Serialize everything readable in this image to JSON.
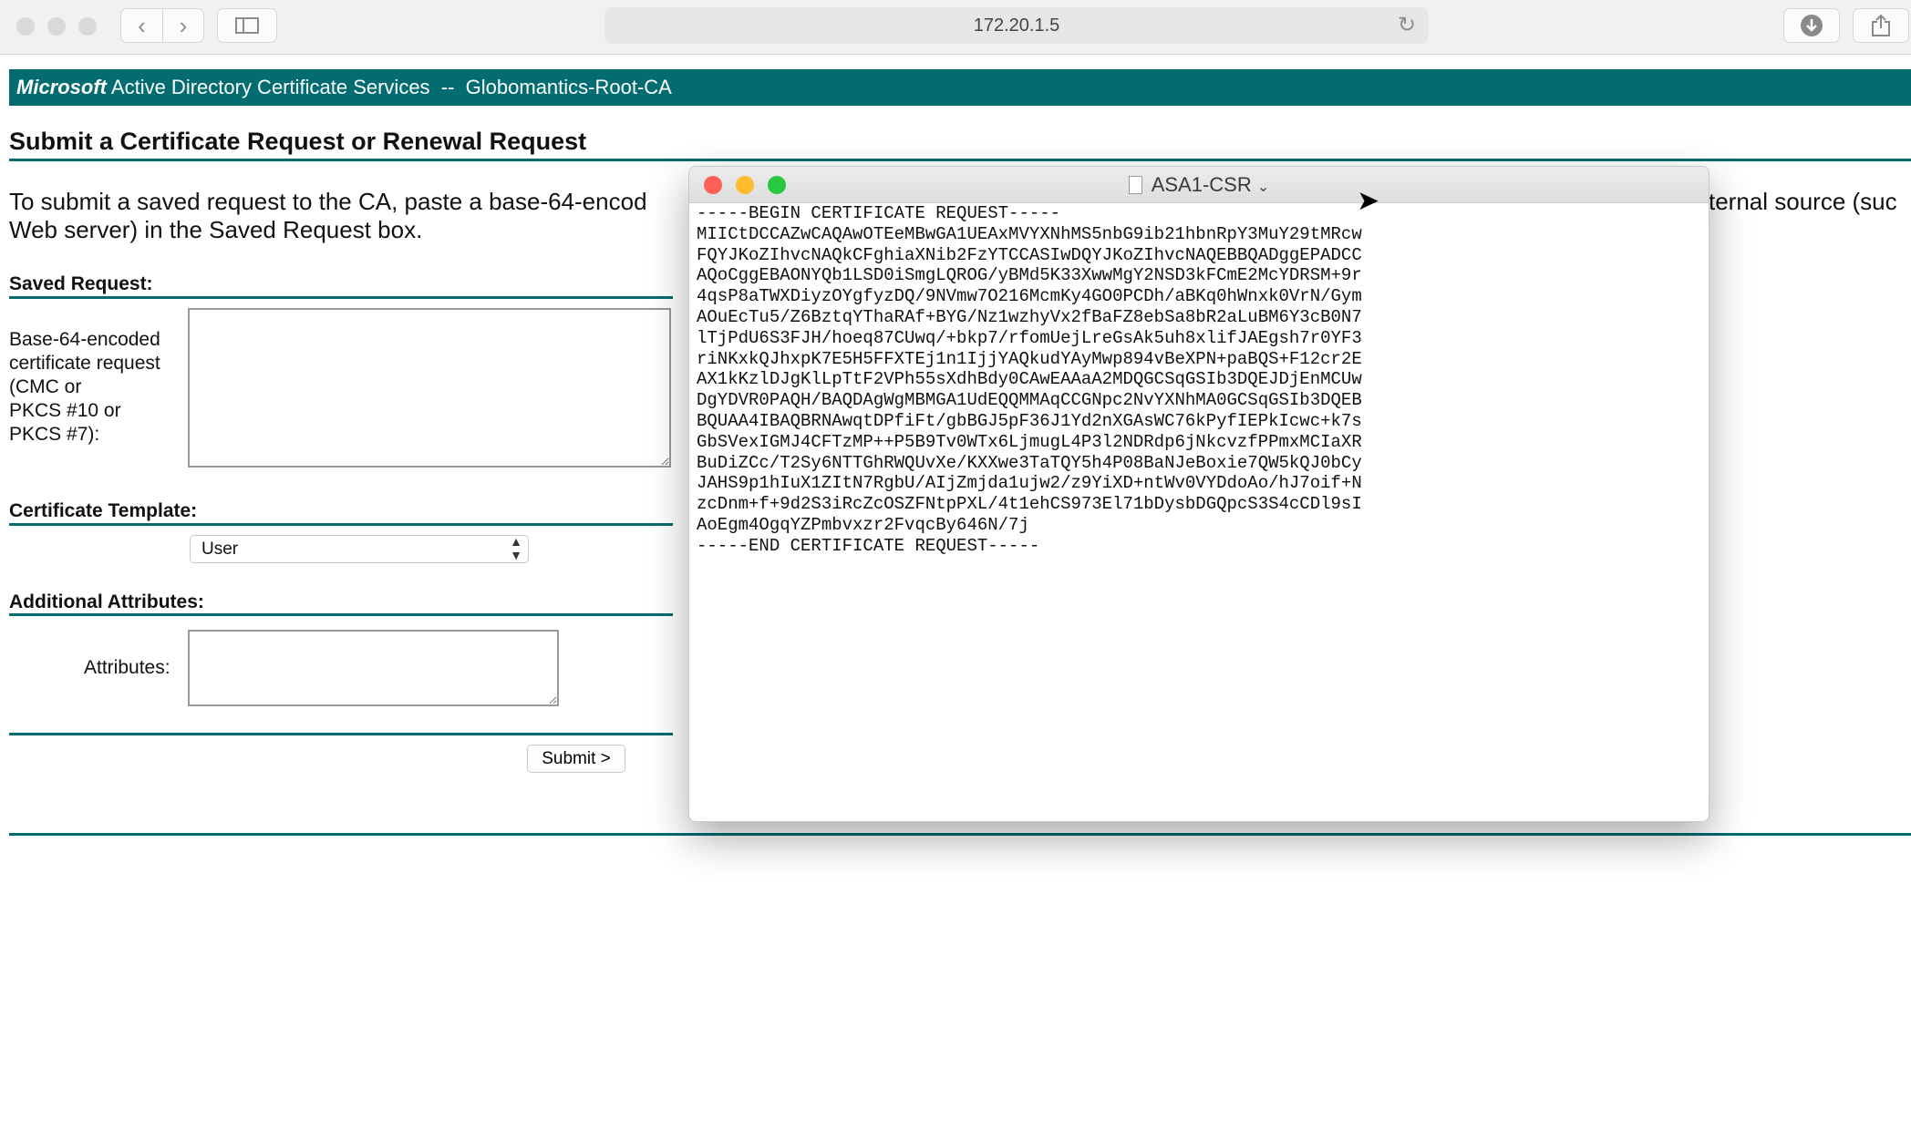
{
  "browser": {
    "url": "172.20.1.5"
  },
  "banner": {
    "brand": "Microsoft",
    "title": "Active Directory Certificate Services  --  Globomantics-Root-CA"
  },
  "page": {
    "heading": "Submit a Certificate Request or Renewal Request",
    "intro_line1": "To submit a saved request to the CA, paste a base-64-encod",
    "intro_line2": "Web server) in the Saved Request box.",
    "intro_tail": "ternal source (suc"
  },
  "form": {
    "saved_request_heading": "Saved Request:",
    "saved_request_label": "Base-64-encoded certificate request (CMC or PKCS #10 or PKCS #7):",
    "saved_request_lines": [
      "Base-64-encoded",
      "certificate request",
      "(CMC or",
      "PKCS #10 or",
      "PKCS #7):"
    ],
    "template_heading": "Certificate Template:",
    "template_selected": "User",
    "attributes_heading": "Additional Attributes:",
    "attributes_label": "Attributes:",
    "submit_label": "Submit >"
  },
  "textedit": {
    "title": "ASA1-CSR",
    "lines": [
      "-----BEGIN CERTIFICATE REQUEST-----",
      "MIICtDCCAZwCAQAwOTEeMBwGA1UEAxMVYXNhMS5nbG9ib21hbnRpY3MuY29tMRcw",
      "FQYJKoZIhvcNAQkCFghiaXNib2FzYTCCASIwDQYJKoZIhvcNAQEBBQADggEPADCC",
      "AQoCggEBAONYQb1LSD0iSmgLQROG/yBMd5K33XwwMgY2NSD3kFCmE2McYDRSM+9r",
      "4qsP8aTWXDiyzOYgfyzDQ/9NVmw7O216McmKy4GO0PCDh/aBKq0hWnxk0VrN/Gym",
      "AOuEcTu5/Z6BztqYThaRAf+BYG/Nz1wzhyVx2fBaFZ8ebSa8bR2aLuBM6Y3cB0N7",
      "lTjPdU6S3FJH/hoeq87CUwq/+bkp7/rfomUejLreGsAk5uh8xlifJAEgsh7r0YF3",
      "riNKxkQJhxpK7E5H5FFXTEj1n1IjjYAQkudYAyMwp894vBeXPN+paBQS+F12cr2E",
      "AX1kKzlDJgKlLpTtF2VPh55sXdhBdy0CAwEAAaA2MDQGCSqGSIb3DQEJDjEnMCUw",
      "DgYDVR0PAQH/BAQDAgWgMBMGA1UdEQQMMAqCCGNpc2NvYXNhMA0GCSqGSIb3DQEB",
      "BQUAA4IBAQBRNAwqtDPfiFt/gbBGJ5pF36J1Yd2nXGAsWC76kPyfIEPkIcwc+k7s",
      "GbSVexIGMJ4CFTzMP++P5B9Tv0WTx6LjmugL4P3l2NDRdp6jNkcvzfPPmxMCIaXR",
      "BuDiZCc/T2Sy6NTTGhRWQUvXe/KXXwe3TaTQY5h4P08BaNJeBoxie7QW5kQJ0bCy",
      "JAHS9p1hIuX1ZItN7RgbU/AIjZmjda1ujw2/z9YiXD+ntWv0VYDdoAo/hJ7oif+N",
      "zcDnm+f+9d2S3iRcZcOSZFNtpPXL/4t1ehCS973El71bDysbDGQpcS3S4cCDl9sI",
      "AoEgm4OgqYZPmbvxzr2FvqcBy646N/7j",
      "-----END CERTIFICATE REQUEST-----"
    ]
  },
  "colors": {
    "accent": "#036c70",
    "traffic_red": "#fe5f57",
    "traffic_yellow": "#febc2e",
    "traffic_green": "#28c840"
  }
}
